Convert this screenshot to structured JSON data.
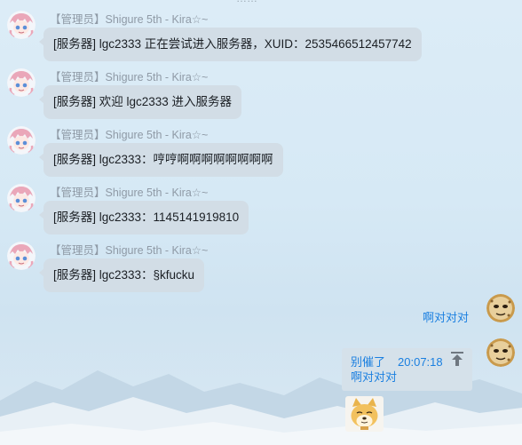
{
  "top_hint": "……",
  "messages": [
    {
      "sender": "【管理员】Shigure 5th - Kira☆~",
      "text": "[服务器] lgc2333 正在尝试进入服务器，XUID：2535466512457742"
    },
    {
      "sender": "【管理员】Shigure 5th - Kira☆~",
      "text": "[服务器] 欢迎 lgc2333 进入服务器"
    },
    {
      "sender": "【管理员】Shigure 5th - Kira☆~",
      "text": "[服务器] lgc2333：哼哼啊啊啊啊啊啊啊啊"
    },
    {
      "sender": "【管理员】Shigure 5th - Kira☆~",
      "text": "[服务器] lgc2333：1145141919810"
    },
    {
      "sender": "【管理员】Shigure 5th - Kira☆~",
      "text": "[服务器] lgc2333：§kfucku"
    }
  ],
  "self_message": {
    "text": "啊对对对"
  },
  "quote_reply": {
    "label": "别催了",
    "time": "20:07:18",
    "text": "啊对对对",
    "icon": "arrow-up-icon"
  },
  "sticker": {
    "icon": "dog-sticker-icon"
  },
  "colors": {
    "bubble": "#d2dde6",
    "self_text": "#1a7fe0",
    "sender": "#8f9aa6"
  }
}
